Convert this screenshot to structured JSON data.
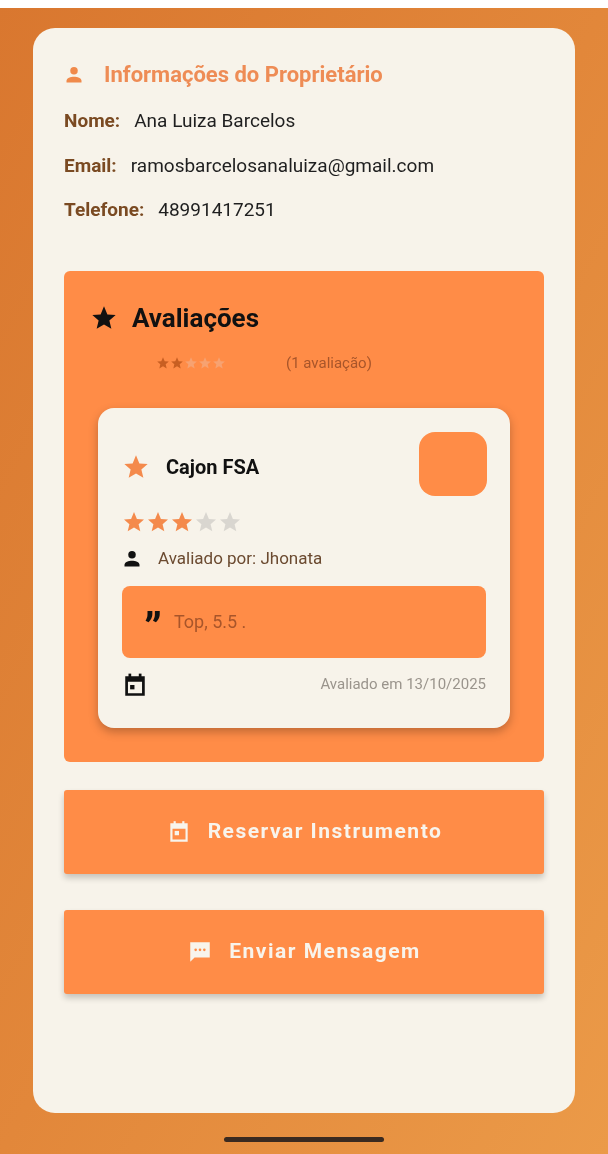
{
  "owner": {
    "title": "Informações do Proprietário",
    "fields": [
      {
        "label": "Nome:",
        "value": "Ana Luiza Barcelos"
      },
      {
        "label": "Email:",
        "value": "ramosbarcelosanaluiza@gmail.com"
      },
      {
        "label": "Telefone:",
        "value": "48991417251"
      }
    ]
  },
  "reviews": {
    "title": "Avaliações",
    "summary": {
      "stars": 2,
      "count": "(1 avaliação)"
    },
    "items": [
      {
        "instrument": "Cajon FSA",
        "stars": 3,
        "reviewer": "Avaliado por: Jhonata",
        "quote": "”",
        "comment": "Top, 5.5 .",
        "date": "Avaliado em 13/10/2025"
      }
    ]
  },
  "buttons": [
    {
      "kind": "reserve",
      "label": "Reservar Instrumento"
    },
    {
      "kind": "message",
      "label": "Enviar Mensagem"
    }
  ]
}
